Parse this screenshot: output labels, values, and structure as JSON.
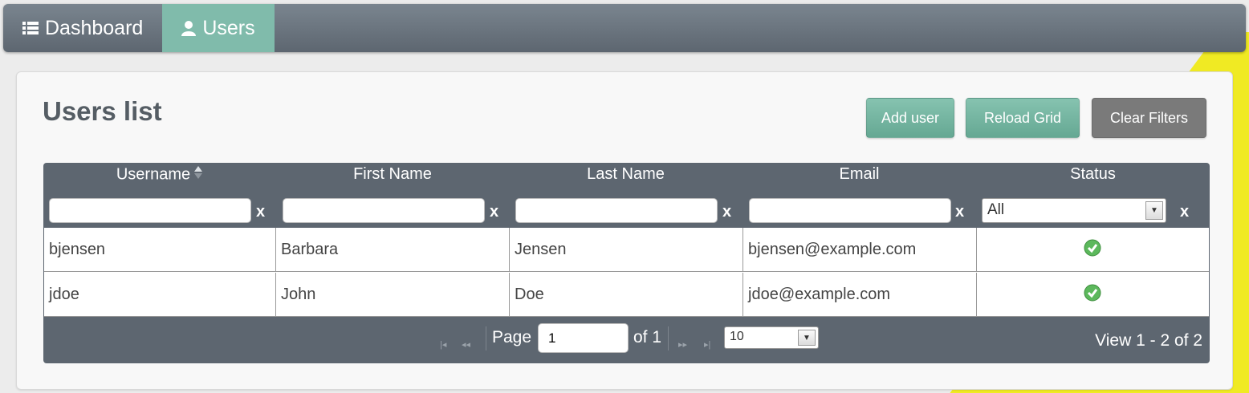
{
  "nav": {
    "items": [
      {
        "label": "Dashboard",
        "icon": "list-icon"
      },
      {
        "label": "Users",
        "icon": "user-icon"
      }
    ]
  },
  "panel": {
    "title": "Users list",
    "buttons": {
      "add_user": "Add user",
      "reload_grid": "Reload Grid",
      "clear_filters": "Clear Filters"
    }
  },
  "grid": {
    "columns": [
      "Username",
      "First Name",
      "Last Name",
      "Email",
      "Status"
    ],
    "filter_clear": "x",
    "status_filter": "All",
    "rows": [
      {
        "username": "bjensen",
        "first_name": "Barbara",
        "last_name": "Jensen",
        "email": "bjensen@example.com",
        "status": "active"
      },
      {
        "username": "jdoe",
        "first_name": "John",
        "last_name": "Doe",
        "email": "jdoe@example.com",
        "status": "active"
      }
    ],
    "pager": {
      "page_label": "Page",
      "page_value": "1",
      "of_label": "of 1",
      "page_size": "10",
      "view_text": "View 1 - 2 of 2"
    }
  },
  "colors": {
    "accent_green": "#80bbab",
    "header_gray": "#5d6670",
    "status_active": "#4caf50"
  }
}
